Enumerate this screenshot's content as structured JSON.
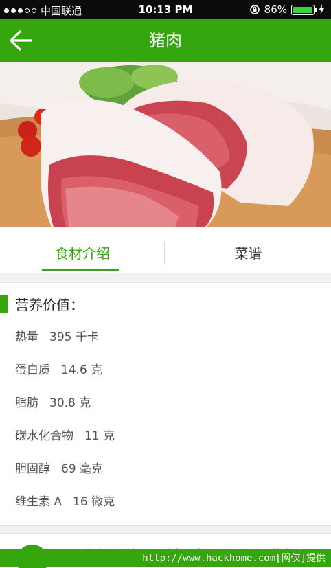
{
  "status_bar": {
    "carrier": "中国联通",
    "time": "10:13 PM",
    "battery_percent": "86%",
    "battery_level": 0.86,
    "signal_icon": "signal-dots-icon",
    "lock_icon": "rotation-lock-icon",
    "charging_icon": "bolt-icon"
  },
  "nav": {
    "title": "猪肉",
    "back_icon": "arrow-left-icon"
  },
  "hero": {
    "image": "raw-pork-photo"
  },
  "tabs": [
    {
      "label": "食材介绍",
      "active": true
    },
    {
      "label": "菜谱",
      "active": false
    }
  ],
  "nutrition": {
    "title": "营养价值：",
    "items": [
      {
        "name": "热量",
        "value": "395 千卡"
      },
      {
        "name": "蛋白质",
        "value": "14.6 克"
      },
      {
        "name": "脂肪",
        "value": "30.8 克"
      },
      {
        "name": "碳水化合物",
        "value": "11 克"
      },
      {
        "name": "胆固醇",
        "value": "69 毫克"
      },
      {
        "name": "维生素 A",
        "value": "16 微克"
      }
    ]
  },
  "bottom": {
    "text": "一般人都可食用，适宜阴虚不足，头晕，贫血"
  },
  "watermark": {
    "text": "http://www.hackhome.com[网侠]提供"
  },
  "colors": {
    "accent": "#35a60d",
    "status_bar": "#0b0b0b",
    "background": "#f2f2f2"
  }
}
